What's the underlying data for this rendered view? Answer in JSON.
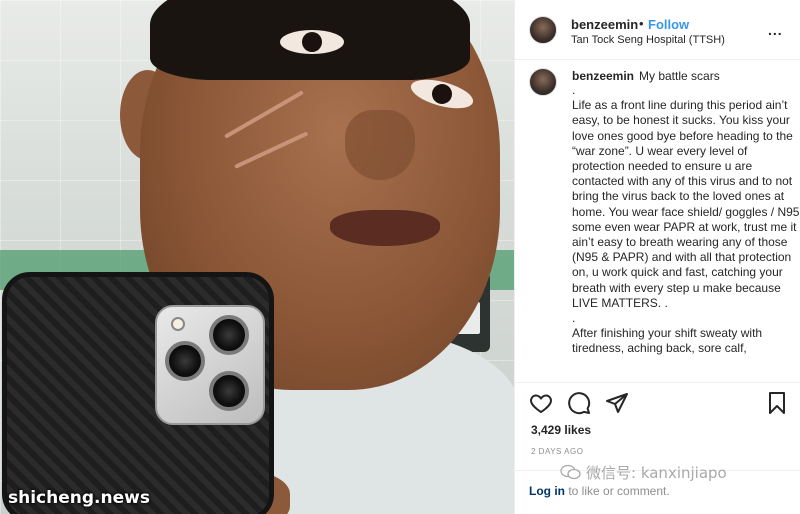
{
  "photo": {
    "watermark": "shicheng.news"
  },
  "post_header": {
    "username": "benzeemin",
    "separator": "•",
    "follow_label": "Follow",
    "location": "Tan Tock Seng Hospital (TTSH)",
    "more_label": "..."
  },
  "caption": {
    "username": "benzeemin",
    "title": "My battle scars",
    "body": ".\nLife as a front line during this period ain’t easy, to be honest it sucks. You kiss your love ones good bye before heading to the “war zone”. U wear every level of protection needed to ensure u are contacted with any of this virus and to not bring the virus back to the loved ones at home. You wear face shield/ goggles / N95 some even wear PAPR at work, trust me it ain’t easy to breath wearing any of those (N95 & PAPR) and with all that protection on, u work quick and fast, catching your breath with every step u make because LIVE MATTERS. .\n.\nAfter finishing your shift sweaty with tiredness, aching back, sore calf,"
  },
  "actions": {
    "icons": [
      "heart-icon",
      "comment-icon",
      "share-icon",
      "bookmark-icon"
    ]
  },
  "stats": {
    "likes": "3,429 likes",
    "time_ago": "2 DAYS AGO"
  },
  "footer": {
    "login_link": "Log in",
    "login_rest": " to like or comment."
  },
  "overlay": {
    "wechat_watermark": "微信号: kanxinjiapo"
  }
}
